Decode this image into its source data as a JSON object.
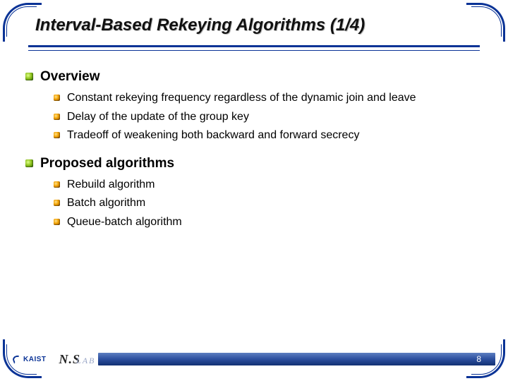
{
  "title": "Interval-Based Rekeying Algorithms (1/4)",
  "sections": [
    {
      "heading": "Overview",
      "items": [
        "Constant rekeying frequency regardless of the dynamic join and leave",
        "Delay of the update of the group key",
        "Tradeoff of weakening both backward and forward secrecy"
      ]
    },
    {
      "heading": "Proposed algorithms",
      "items": [
        "Rebuild algorithm",
        "Batch algorithm",
        "Queue-batch algorithm"
      ]
    }
  ],
  "footer": {
    "org": "KAIST",
    "lab_bold": "N.S",
    "lab_small": "LAB",
    "page": "8"
  }
}
